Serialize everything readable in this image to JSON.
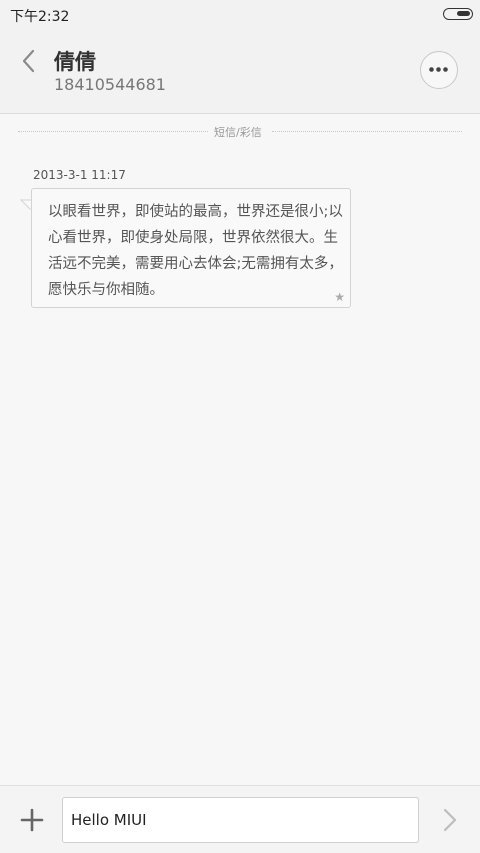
{
  "status_bar": {
    "time": "下午2:32"
  },
  "header": {
    "contact_name": "倩倩",
    "contact_number": "18410544681"
  },
  "thread": {
    "divider_label": "短信/彩信",
    "messages": [
      {
        "timestamp": "2013-3-1 11:17",
        "text": "以眼看世界，即使站的最高，世界还是很小;以心看世界，即使身处局限，世界依然很大。生活远不完美，需要用心去体会;无需拥有太多，愿快乐与你相随。",
        "starred": true
      }
    ]
  },
  "composer": {
    "input_value": "Hello MIUI"
  },
  "colors": {
    "background": "#f7f7f7",
    "header_bg": "#f2f2f2",
    "bubble_border": "#d3d3d3",
    "text_muted": "#777777"
  },
  "icons": {
    "back": "chevron-left-icon",
    "more": "more-dots-icon",
    "star": "star-icon",
    "add": "plus-icon",
    "send": "chevron-right-icon",
    "battery": "battery-icon"
  }
}
